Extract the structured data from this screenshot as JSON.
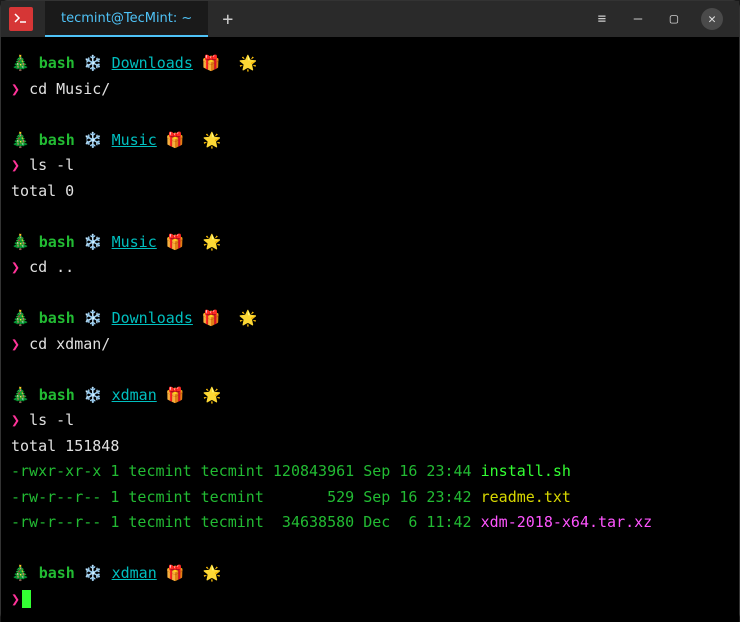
{
  "titlebar": {
    "tab_title": "tecmint@TecMint: ~",
    "plus": "+",
    "menu": "≡",
    "min": "—",
    "max": "▢",
    "close": "✕"
  },
  "emoji": {
    "tree": "🎄",
    "snow": "❄️",
    "gift": "🎁",
    "star": "🌟"
  },
  "shell": "bash",
  "prompt_char": "❯",
  "blocks": [
    {
      "dir": "Downloads",
      "cmd": "cd Music/"
    },
    {
      "dir": "Music",
      "cmd": "ls -l"
    }
  ],
  "ls1_output": "total 0",
  "block3": {
    "dir": "Music",
    "cmd": "cd .."
  },
  "block4": {
    "dir": "Downloads",
    "cmd": "cd xdman/"
  },
  "block5": {
    "dir": "xdman",
    "cmd": "ls -l"
  },
  "ls2_total": "total 151848",
  "ls2_rows": [
    {
      "perms": "-rwxr-xr-x 1 tecmint tecmint 120843961 Sep 16 23:44 ",
      "file": "install.sh",
      "cls": "bright-green"
    },
    {
      "perms": "-rw-r--r-- 1 tecmint tecmint       529 Sep 16 23:42 ",
      "file": "readme.txt",
      "cls": "yellow"
    },
    {
      "perms": "-rw-r--r-- 1 tecmint tecmint  34638580 Dec  6 11:42 ",
      "file": "xdm-2018-x64.tar.xz",
      "cls": "bright-magenta"
    }
  ],
  "block6": {
    "dir": "xdman"
  }
}
